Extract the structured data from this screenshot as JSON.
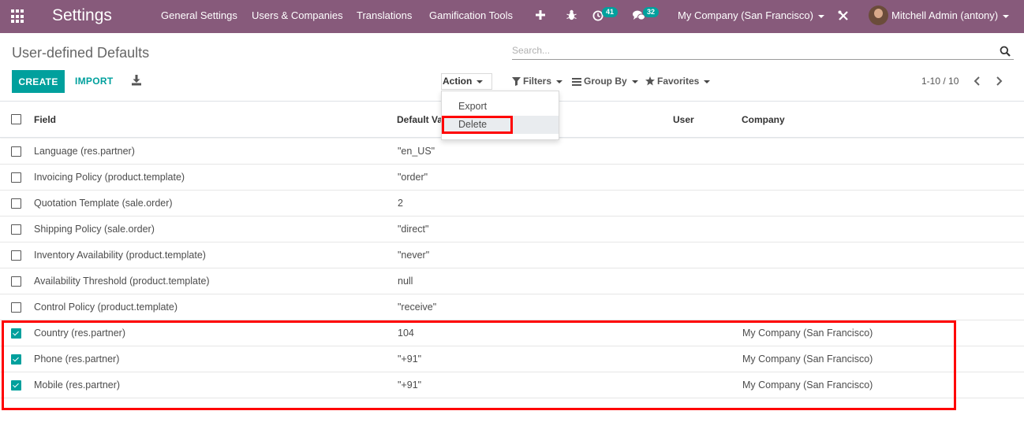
{
  "navbar": {
    "app_title": "Settings",
    "menu": [
      "General Settings",
      "Users & Companies",
      "Translations",
      "Gamification Tools"
    ],
    "activity_count": "41",
    "message_count": "32",
    "company": "My Company (San Francisco)",
    "user": "Mitchell Admin (antony)"
  },
  "control_panel": {
    "title": "User-defined Defaults",
    "search_placeholder": "Search...",
    "create_label": "CREATE",
    "import_label": "IMPORT",
    "action_label": "Action",
    "filters_label": "Filters",
    "groupby_label": "Group By",
    "favorites_label": "Favorites",
    "pager": "1-10 / 10"
  },
  "action_menu": {
    "export_label": "Export",
    "delete_label": "Delete"
  },
  "table": {
    "columns": [
      "Field",
      "Default Va",
      "User",
      "Company"
    ],
    "rows": [
      {
        "field": "Language (res.partner)",
        "value": "\"en_US\"",
        "user": "",
        "company": "",
        "checked": false
      },
      {
        "field": "Invoicing Policy (product.template)",
        "value": "\"order\"",
        "user": "",
        "company": "",
        "checked": false
      },
      {
        "field": "Quotation Template (sale.order)",
        "value": "2",
        "user": "",
        "company": "",
        "checked": false
      },
      {
        "field": "Shipping Policy (sale.order)",
        "value": "\"direct\"",
        "user": "",
        "company": "",
        "checked": false
      },
      {
        "field": "Inventory Availability (product.template)",
        "value": "\"never\"",
        "user": "",
        "company": "",
        "checked": false
      },
      {
        "field": "Availability Threshold (product.template)",
        "value": "null",
        "user": "",
        "company": "",
        "checked": false
      },
      {
        "field": "Control Policy (product.template)",
        "value": "\"receive\"",
        "user": "",
        "company": "",
        "checked": false
      },
      {
        "field": "Country (res.partner)",
        "value": "104",
        "user": "",
        "company": "My Company (San Francisco)",
        "checked": true
      },
      {
        "field": "Phone (res.partner)",
        "value": "\"+91\"",
        "user": "",
        "company": "My Company (San Francisco)",
        "checked": true
      },
      {
        "field": "Mobile (res.partner)",
        "value": "\"+91\"",
        "user": "",
        "company": "My Company (San Francisco)",
        "checked": true
      }
    ]
  },
  "colors": {
    "navbar": "#875a7b",
    "primary": "#00a09d",
    "highlight": "#ff0000"
  },
  "icons": {
    "apps": "apps-grid-icon",
    "plus": "plus-icon",
    "bug": "bug-icon",
    "activity": "clock-icon",
    "messages": "chat-icon",
    "tools": "tools-icon",
    "search": "search-icon",
    "download": "download-icon",
    "filter": "filter-icon",
    "groupby": "list-icon",
    "favorites": "star-icon"
  }
}
